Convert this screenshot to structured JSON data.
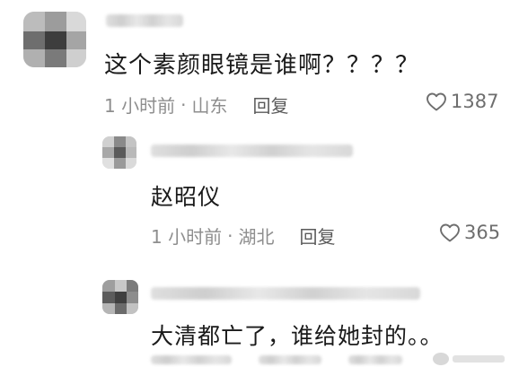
{
  "comments": [
    {
      "text": "这个素颜眼镜是谁啊？？？？",
      "time": "1 小时前",
      "location": "山东",
      "reply_label": "回复",
      "likes": "1387"
    },
    {
      "text": "赵昭仪",
      "time": "1 小时前",
      "location": "湖北",
      "reply_label": "回复",
      "likes": "365"
    },
    {
      "text": "大清都亡了，谁给她封的。。",
      "time": "",
      "location": "",
      "reply_label": "",
      "likes": ""
    }
  ],
  "meta_separator": "·",
  "icons": {
    "like": "heart-outline-icon"
  },
  "colors": {
    "text": "#1a1a1a",
    "meta": "#8e8e8e",
    "reply": "#5a5a5a",
    "like": "#6e6e6e",
    "background": "#ffffff"
  }
}
